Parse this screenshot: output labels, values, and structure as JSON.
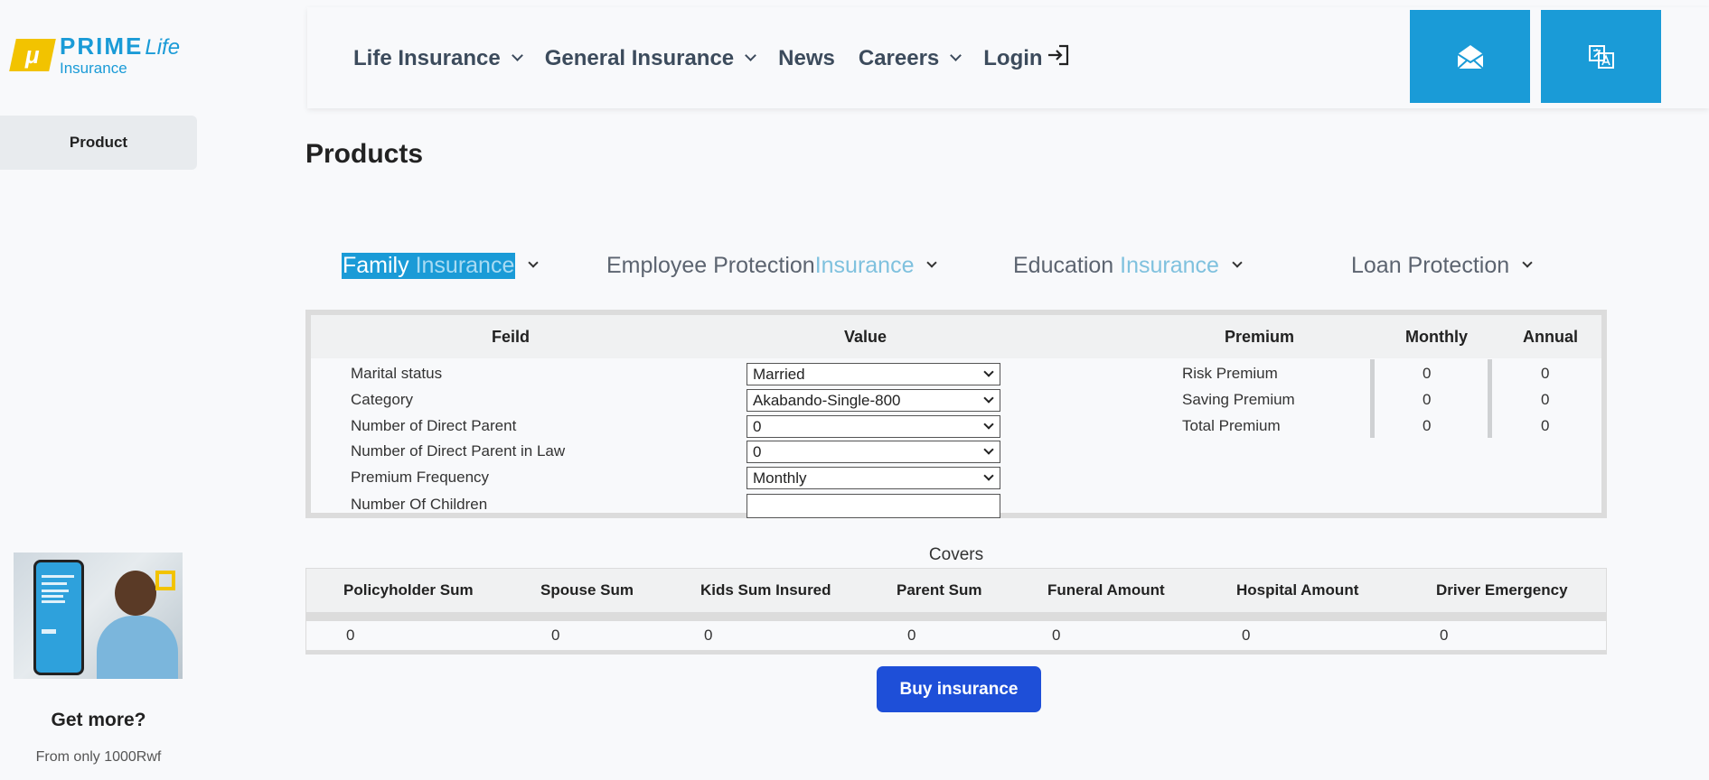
{
  "brand": {
    "name_main": "PRIME",
    "name_script": "Life",
    "name_sub": "Insurance",
    "mark": "μ",
    "accent": "#1a9bd7",
    "yellow": "#f2c300"
  },
  "sidebar": {
    "product_label": "Product",
    "promo_heading": "Get more?",
    "promo_sub": "From only 1000Rwf"
  },
  "nav": {
    "items": [
      {
        "label": "Life Insurance",
        "dropdown": true
      },
      {
        "label": "General Insurance",
        "dropdown": true
      },
      {
        "label": "News",
        "dropdown": false
      },
      {
        "label": "Careers",
        "dropdown": true
      },
      {
        "label": "Login",
        "icon": "login-icon"
      }
    ],
    "buttons": [
      {
        "icon": "mail-open-icon",
        "glyph": "✉"
      },
      {
        "icon": "translate-icon",
        "glyph": "文A"
      }
    ]
  },
  "page_title": "Products",
  "tabs": [
    {
      "main": "Family ",
      "hl": "Insurance",
      "active": true
    },
    {
      "main": "Employee Protection",
      "hl": "Insurance",
      "active": false
    },
    {
      "main": "Education ",
      "hl": "Insurance",
      "active": false
    },
    {
      "main": "Loan Protection",
      "hl": "",
      "active": false
    }
  ],
  "calculator": {
    "headers": {
      "field": "Feild",
      "value": "Value",
      "premium": "Premium",
      "monthly": "Monthly",
      "annual": "Annual"
    },
    "fields": [
      {
        "label": "Marital status",
        "value": "Married",
        "type": "select"
      },
      {
        "label": "Category",
        "value": "Akabando-Single-800",
        "type": "select"
      },
      {
        "label": "Number of Direct Parent",
        "value": "0",
        "type": "select"
      },
      {
        "label": "Number of Direct Parent in Law",
        "value": "0",
        "type": "select"
      },
      {
        "label": "Premium Frequency",
        "value": "Monthly",
        "type": "select"
      },
      {
        "label": "Number Of Children",
        "value": "",
        "type": "input"
      }
    ],
    "premiums": [
      {
        "label": "Risk Premium",
        "monthly": "0",
        "annual": "0"
      },
      {
        "label": "Saving Premium",
        "monthly": "0",
        "annual": "0"
      },
      {
        "label": "Total Premium",
        "monthly": "0",
        "annual": "0"
      }
    ]
  },
  "covers": {
    "title": "Covers",
    "columns": [
      "Policyholder Sum",
      "Spouse Sum",
      "Kids Sum Insured",
      "Parent Sum",
      "Funeral Amount",
      "Hospital Amount",
      "Driver Emergency"
    ],
    "values": [
      "0",
      "0",
      "0",
      "0",
      "0",
      "0",
      "0"
    ]
  },
  "buy_button": "Buy insurance"
}
